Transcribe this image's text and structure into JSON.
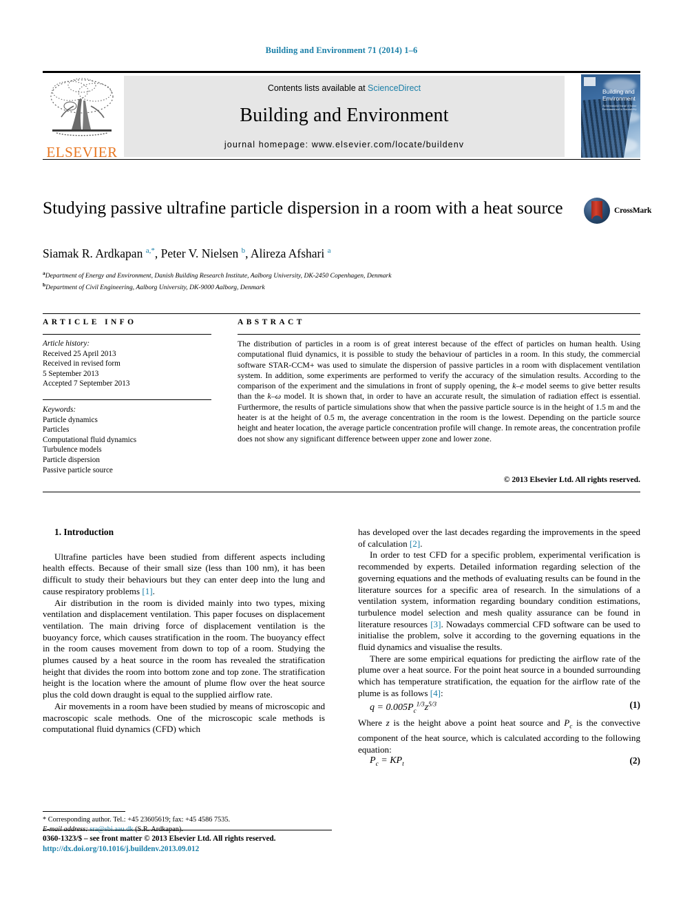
{
  "running_head": "Building and Environment 71 (2014) 1–6",
  "masthead": {
    "contents_prefix": "Contents lists available at",
    "sciencedirect": "ScienceDirect",
    "journal_name": "Building and Environment",
    "homepage": "journal homepage: www.elsevier.com/locate/buildenv",
    "publisher_logo_text": "ELSEVIER",
    "cover_title": "Building and Environment",
    "cover_subtitle": "An International Journal of Indoor Environment and its Sustainability"
  },
  "article": {
    "title": "Studying passive ultrafine particle dispersion in a room with a heat source",
    "crossmark_label": "CrossMark",
    "authors_html": "Siamak R. Ardkapan <sup>a,*</sup>, Peter V. Nielsen <sup>b</sup>, Alireza Afshari <sup>a</sup>",
    "affiliations": [
      {
        "marker": "a",
        "text": "Department of Energy and Environment, Danish Building Research Institute, Aalborg University, DK-2450 Copenhagen, Denmark"
      },
      {
        "marker": "b",
        "text": "Department of Civil Engineering, Aalborg University, DK-9000 Aalborg, Denmark"
      }
    ]
  },
  "info": {
    "heading": "ARTICLE INFO",
    "history_label": "Article history:",
    "history": [
      "Received 25 April 2013",
      "Received in revised form",
      "5 September 2013",
      "Accepted 7 September 2013"
    ],
    "keywords_label": "Keywords:",
    "keywords": [
      "Particle dynamics",
      "Particles",
      "Computational fluid dynamics",
      "Turbulence models",
      "Particle dispersion",
      "Passive particle source"
    ]
  },
  "abstract": {
    "heading": "ABSTRACT",
    "text": "The distribution of particles in a room is of great interest because of the effect of particles on human health. Using computational fluid dynamics, it is possible to study the behaviour of particles in a room. In this study, the commercial software STAR-CCM+ was used to simulate the dispersion of passive particles in a room with displacement ventilation system. In addition, some experiments are performed to verify the accuracy of the simulation results. According to the comparison of the experiment and the simulations in front of supply opening, the k–e model seems to give better results than the k–ω model. It is shown that, in order to have an accurate result, the simulation of radiation effect is essential. Furthermore, the results of particle simulations show that when the passive particle source is in the height of 1.5 m and the heater is at the height of 0.5 m, the average concentration in the room is the lowest. Depending on the particle source height and heater location, the average particle concentration profile will change. In remote areas, the concentration profile does not show any significant difference between upper zone and lower zone.",
    "copyright": "© 2013 Elsevier Ltd. All rights reserved."
  },
  "body": {
    "section_heading": "1. Introduction",
    "left_paragraphs": [
      "Ultrafine particles have been studied from different aspects including health effects. Because of their small size (less than 100 nm), it has been difficult to study their behaviours but they can enter deep into the lung and cause respiratory problems [1].",
      "Air distribution in the room is divided mainly into two types, mixing ventilation and displacement ventilation. This paper focuses on displacement ventilation. The main driving force of displacement ventilation is the buoyancy force, which causes stratification in the room. The buoyancy effect in the room causes movement from down to top of a room. Studying the plumes caused by a heat source in the room has revealed the stratification height that divides the room into bottom zone and top zone. The stratification height is the location where the amount of plume flow over the heat source plus the cold down draught is equal to the supplied airflow rate.",
      "Air movements in a room have been studied by means of microscopic and macroscopic scale methods. One of the microscopic scale methods is computational fluid dynamics (CFD) which"
    ],
    "right_paragraphs": [
      "has developed over the last decades regarding the improvements in the speed of calculation [2].",
      "In order to test CFD for a specific problem, experimental verification is recommended by experts. Detailed information regarding selection of the governing equations and the methods of evaluating results can be found in the literature sources for a specific area of research. In the simulations of a ventilation system, information regarding boundary condition estimations, turbulence model selection and mesh quality assurance can be found in literature resources [3]. Nowadays commercial CFD software can be used to initialise the problem, solve it according to the governing equations in the fluid dynamics and visualise the results.",
      "There are some empirical equations for predicting the airflow rate of the plume over a heat source. For the point heat source in a bounded surrounding which has temperature stratification, the equation for the airflow rate of the plume is as follows [4]:"
    ],
    "equation_1": {
      "label": "(1)",
      "text": "q = 0.005Pc1/3z5/3"
    },
    "between_equations": "Where z is the height above a point heat source and Pc is the convective component of the heat source, which is calculated according to the following equation:",
    "equation_2": {
      "label": "(2)",
      "text": "Pc = KPt"
    }
  },
  "footnote": {
    "corresponding": "* Corresponding author. Tel.: +45 23605619; fax: +45 4586 7535.",
    "email_label": "E-mail address:",
    "email": "sra@sbi.aau.dk",
    "email_owner": "(S.R. Ardkapan)."
  },
  "footer": {
    "issn_line": "0360-1323/$ – see front matter © 2013 Elsevier Ltd. All rights reserved.",
    "doi": "http://dx.doi.org/10.1016/j.buildenv.2013.09.012"
  },
  "colors": {
    "link": "#1a7fa8",
    "elsevier_orange": "#E87722"
  }
}
